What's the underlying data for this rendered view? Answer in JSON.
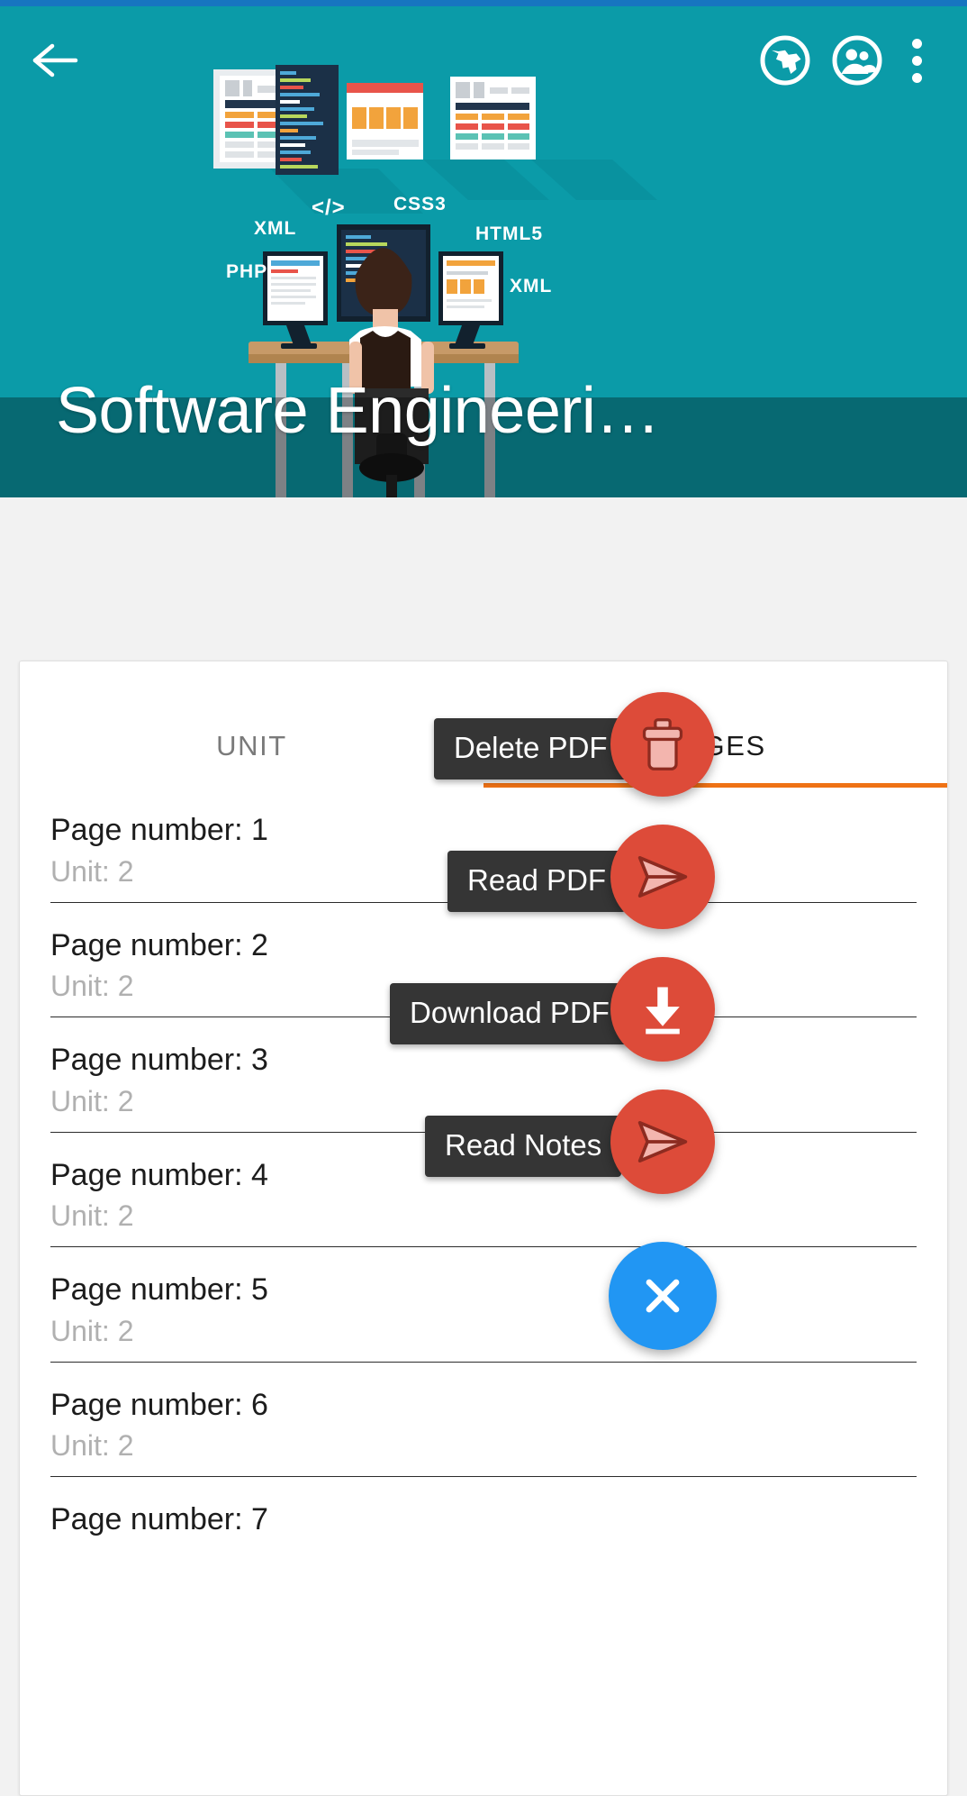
{
  "app": {
    "title": "Software Engineeri…",
    "accent_teal": "#0b9ba8",
    "status_bar_color": "#1775c0",
    "tab_indicator_color": "#ef7215",
    "fab_mini_color": "#dd4b39",
    "fab_main_color": "#2196f3"
  },
  "appbar": {
    "back_icon": "back-arrow-icon",
    "globe_icon": "globe-icon",
    "group_icon": "group-people-icon",
    "overflow_icon": "overflow-menu-icon"
  },
  "hero": {
    "tags": [
      "XML",
      "</>",
      "CSS3",
      "HTML5",
      "PHP",
      "XML"
    ]
  },
  "tabs": [
    {
      "label": "UNIT",
      "active": false
    },
    {
      "label": "PAGES",
      "active": true
    }
  ],
  "list": {
    "rows": [
      {
        "title": "Page number: 1",
        "sub": "Unit: 2"
      },
      {
        "title": "Page number: 2",
        "sub": "Unit: 2"
      },
      {
        "title": "Page number: 3",
        "sub": "Unit: 2"
      },
      {
        "title": "Page number: 4",
        "sub": "Unit: 2"
      },
      {
        "title": "Page number: 5",
        "sub": "Unit: 2"
      },
      {
        "title": "Page number: 6",
        "sub": "Unit: 2"
      },
      {
        "title": "Page number: 7",
        "sub": ""
      }
    ]
  },
  "speed_dial": {
    "open": true,
    "actions": [
      {
        "label": "Delete PDF",
        "icon": "trash-icon"
      },
      {
        "label": "Read PDF",
        "icon": "send-icon"
      },
      {
        "label": "Download PDF",
        "icon": "download-icon"
      },
      {
        "label": "Read Notes",
        "icon": "send-icon"
      }
    ],
    "main": {
      "icon": "close-icon"
    }
  }
}
